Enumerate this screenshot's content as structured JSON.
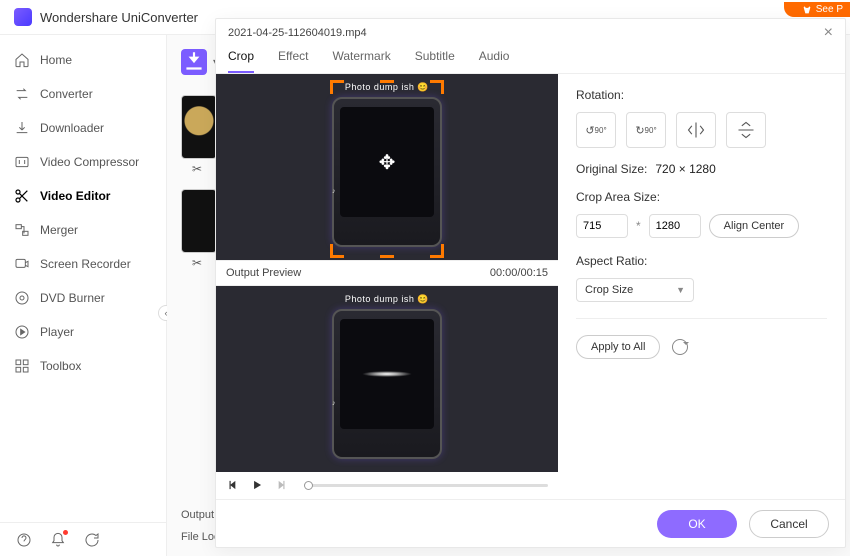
{
  "app": {
    "name": "Wondershare UniConverter",
    "see_label": "See P"
  },
  "sidebar": {
    "items": [
      {
        "label": "Home"
      },
      {
        "label": "Converter"
      },
      {
        "label": "Downloader"
      },
      {
        "label": "Video Compressor"
      },
      {
        "label": "Video Editor"
      },
      {
        "label": "Merger"
      },
      {
        "label": "Screen Recorder"
      },
      {
        "label": "DVD Burner"
      },
      {
        "label": "Player"
      },
      {
        "label": "Toolbox"
      }
    ]
  },
  "content": {
    "output_label": "Output F",
    "file_loc_label": "File Loca"
  },
  "modal": {
    "filename": "2021-04-25-112604019.mp4",
    "tabs": [
      {
        "label": "Crop"
      },
      {
        "label": "Effect"
      },
      {
        "label": "Watermark"
      },
      {
        "label": "Subtitle"
      },
      {
        "label": "Audio"
      }
    ],
    "output_preview_label": "Output Preview",
    "time_display": "00:00/00:15",
    "video_caption": "Photo dump ish 😊",
    "rotation_label": "Rotation:",
    "rot_left": "90°",
    "rot_right": "90°",
    "original_size_label": "Original Size:",
    "original_size_value": "720 × 1280",
    "crop_area_label": "Crop Area Size:",
    "crop_w": "715",
    "crop_h": "1280",
    "align_center_label": "Align Center",
    "aspect_ratio_label": "Aspect Ratio:",
    "aspect_ratio_value": "Crop Size",
    "apply_all_label": "Apply to All",
    "ok_label": "OK",
    "cancel_label": "Cancel"
  }
}
